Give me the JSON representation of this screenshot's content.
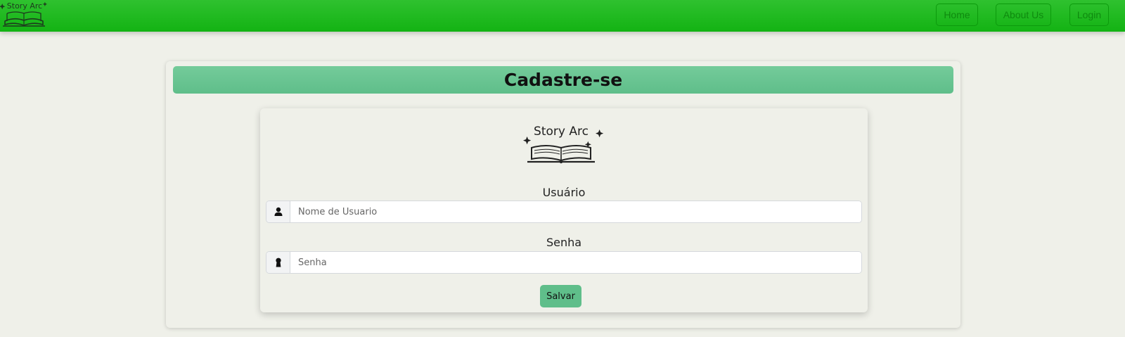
{
  "brand": {
    "logo_text": "Story Arc",
    "logo_icon": "open-book-icon"
  },
  "nav": {
    "items": [
      {
        "label": "Home"
      },
      {
        "label": "About Us"
      },
      {
        "label": "Login"
      }
    ]
  },
  "page": {
    "title": "Cadastre-se"
  },
  "form": {
    "username": {
      "label": "Usuário",
      "placeholder": "Nome de Usuario",
      "value": "",
      "icon": "user-icon"
    },
    "password": {
      "label": "Senha",
      "placeholder": "Senha",
      "value": "",
      "icon": "keyhole-icon"
    },
    "submit_label": "Salvar"
  },
  "colors": {
    "navbar": "#13b313",
    "nav_button_text": "#0e8a0e",
    "title_bar": "#5fbe8a",
    "save_button": "#5fbe8a",
    "background": "#eff0e9"
  }
}
